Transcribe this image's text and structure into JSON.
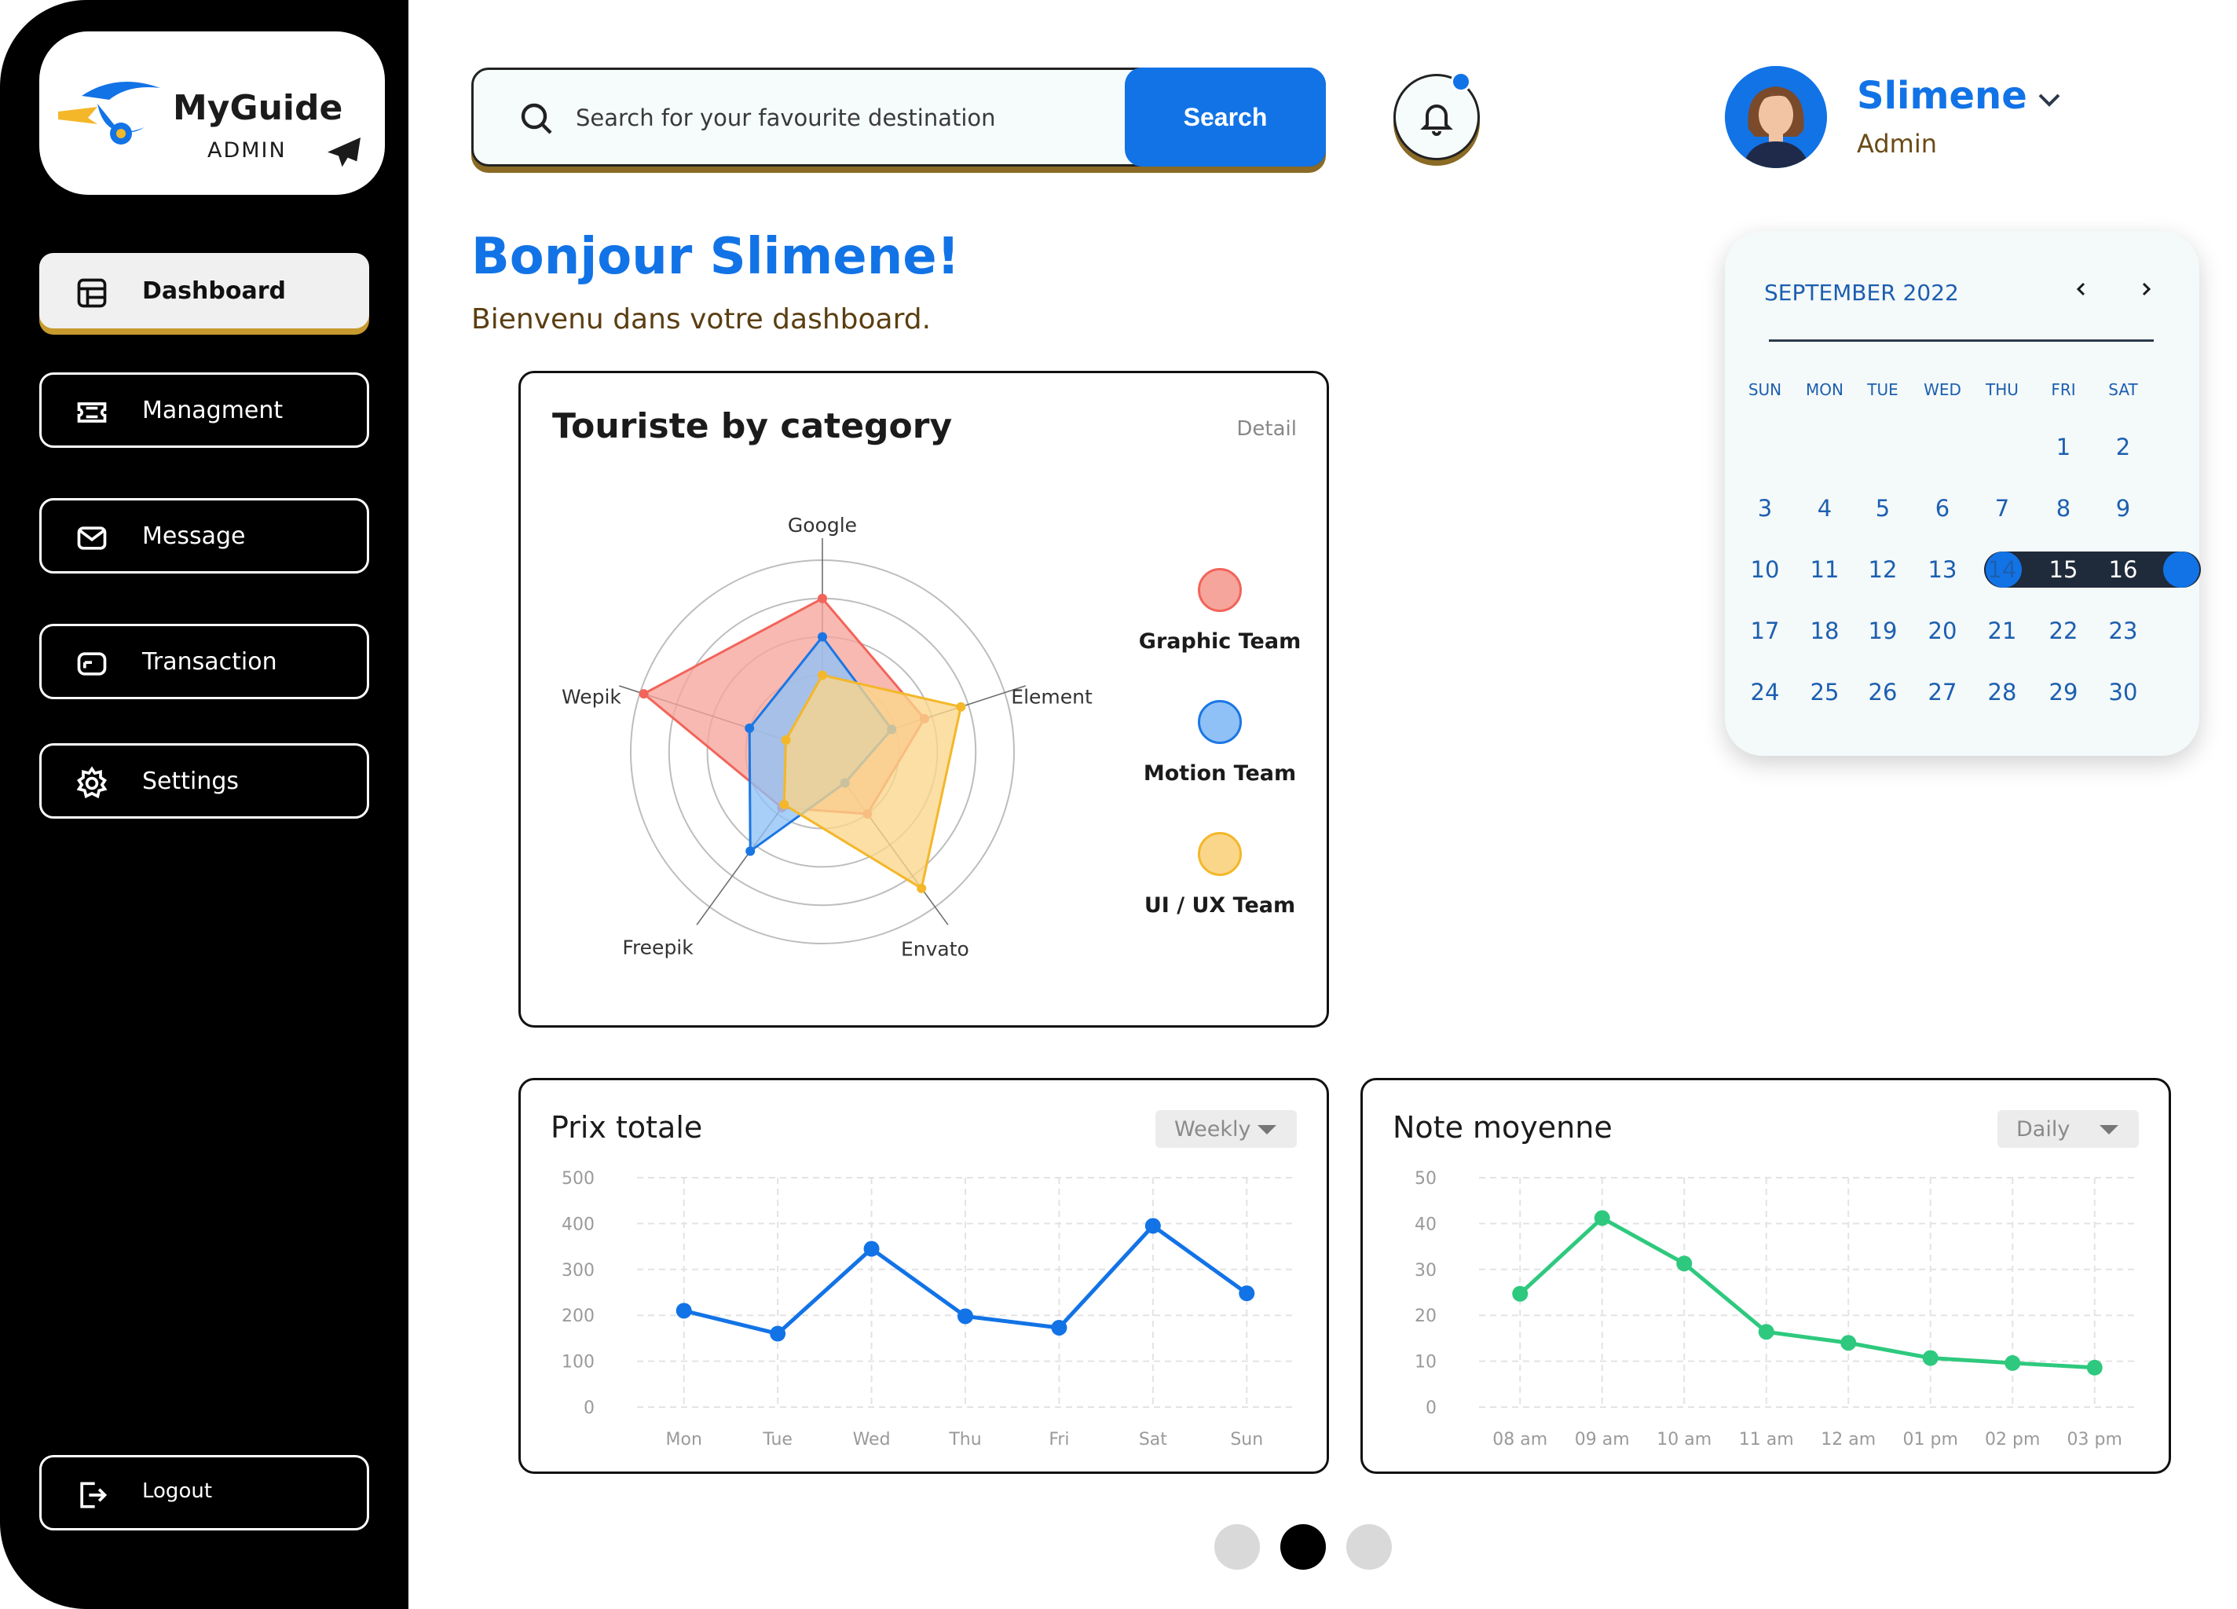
{
  "brand": {
    "name": "MyGuide",
    "subtitle": "ADMIN"
  },
  "sidebar": {
    "items": [
      {
        "label": "Dashboard",
        "icon": "dashboard-icon",
        "active": true
      },
      {
        "label": "Managment",
        "icon": "ticket-icon",
        "active": false
      },
      {
        "label": "Message",
        "icon": "mail-icon",
        "active": false
      },
      {
        "label": "Transaction",
        "icon": "card-icon",
        "active": false
      },
      {
        "label": "Settings",
        "icon": "gear-icon",
        "active": false
      }
    ],
    "logout": {
      "label": "Logout",
      "icon": "logout-icon"
    }
  },
  "search": {
    "placeholder": "Search for your favourite destination",
    "button_label": "Search"
  },
  "user": {
    "name": "Slimene",
    "role": "Admin"
  },
  "greeting": {
    "title": "Bonjour Slimene!",
    "subtitle": "Bienvenu dans votre dashboard."
  },
  "calendar": {
    "month_label": "SEPTEMBER 2022",
    "weekdays": [
      "SUN",
      "MON",
      "TUE",
      "WED",
      "THU",
      "FRI",
      "SAT"
    ],
    "first_weekday_index": 5,
    "days_in_month": 30,
    "selected_range": [
      15,
      16
    ]
  },
  "radar": {
    "title": "Touriste by category",
    "detail_label": "Detail",
    "legend": [
      {
        "label": "Graphic Team",
        "color": "#f2645a",
        "fill": "#f6a59c"
      },
      {
        "label": "Motion Team",
        "color": "#1b76e4",
        "fill": "#8fc1f6"
      },
      {
        "label": "UI / UX Team",
        "color": "#f4b72a",
        "fill": "#fad68a"
      }
    ]
  },
  "pagination": {
    "count": 3,
    "active_index": 1
  },
  "chart_data": [
    {
      "type": "radar",
      "title": "Touriste by category",
      "categories": [
        "Google",
        "Element",
        "Envato",
        "Freepik",
        "Wepik"
      ],
      "rmax": 5,
      "rings": 5,
      "series": [
        {
          "name": "Graphic Team",
          "values": [
            4.0,
            2.8,
            2.0,
            1.8,
            4.9
          ],
          "color": "#f2645a"
        },
        {
          "name": "Motion Team",
          "values": [
            3.0,
            1.9,
            1.0,
            3.2,
            2.0
          ],
          "color": "#1b76e4"
        },
        {
          "name": "UI / UX Team",
          "values": [
            2.0,
            3.8,
            4.4,
            1.7,
            1.0
          ],
          "color": "#f4b72a"
        }
      ]
    },
    {
      "type": "line",
      "title": "Prix totale",
      "period": "Weekly",
      "categories": [
        "Mon",
        "Tue",
        "Wed",
        "Thu",
        "Fri",
        "Sat",
        "Sun"
      ],
      "values": [
        210,
        160,
        345,
        198,
        173,
        395,
        248
      ],
      "ylim": [
        0,
        500
      ],
      "yticks": [
        0,
        100,
        200,
        300,
        400,
        500
      ],
      "color": "#1273e6",
      "grid": true
    },
    {
      "type": "line",
      "title": "Note moyenne",
      "period": "Daily",
      "categories": [
        "08 am",
        "09 am",
        "10 am",
        "11 am",
        "12 am",
        "01 pm",
        "02 pm",
        "03 pm"
      ],
      "values": [
        24.7,
        41.2,
        31.3,
        16.4,
        14.0,
        10.7,
        9.6,
        8.6
      ],
      "ylim": [
        0,
        50
      ],
      "yticks": [
        0,
        10,
        20,
        30,
        40,
        50
      ],
      "color": "#2ec97e",
      "grid": true
    }
  ]
}
